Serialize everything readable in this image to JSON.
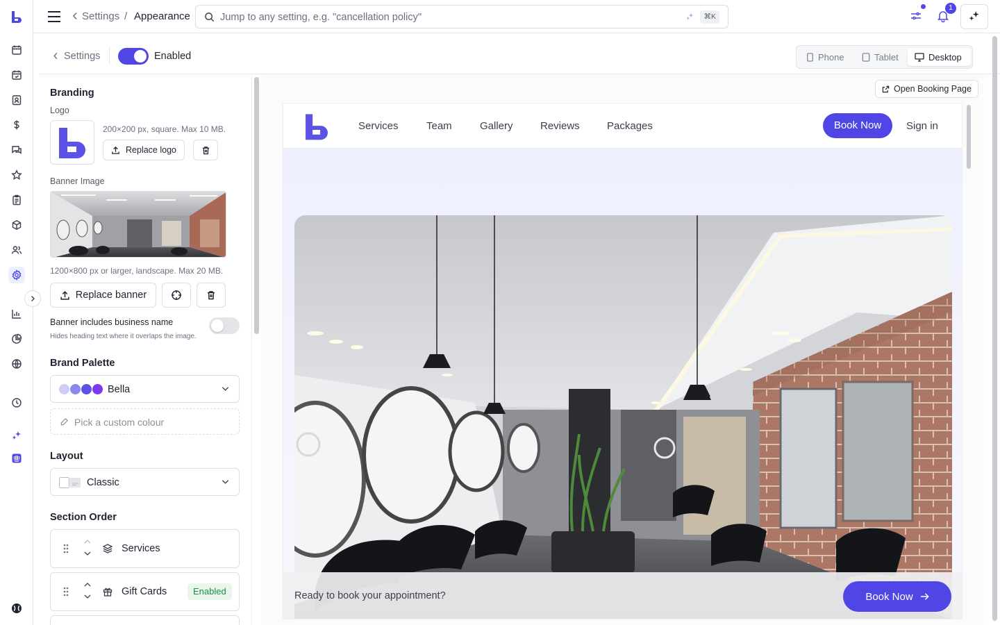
{
  "topbar": {
    "breadcrumb_parent": "Settings",
    "breadcrumb_sep": "/",
    "breadcrumb_current": "Appearance",
    "search_placeholder": "Jump to any setting, e.g. \"cancellation policy\"",
    "search_shortcut": "⌘K",
    "notification_count": "1"
  },
  "subheader": {
    "back_label": "Settings",
    "enabled_label": "Enabled",
    "devices": [
      "Phone",
      "Tablet",
      "Desktop"
    ],
    "selected_device": "Desktop"
  },
  "branding": {
    "heading": "Branding",
    "logo_label": "Logo",
    "logo_hint": "200×200 px, square. Max 10 MB.",
    "replace_logo": "Replace logo",
    "banner_label": "Banner Image",
    "banner_hint": "1200×800 px or larger, landscape. Max 20 MB.",
    "replace_banner": "Replace banner",
    "banner_name_label": "Banner includes business name",
    "banner_name_help": "Hides heading text where it overlaps the image."
  },
  "palette": {
    "heading": "Brand Palette",
    "selected": "Bella",
    "swatches": [
      "#cfcdf7",
      "#8d86ee",
      "#5d52e6",
      "#7c3aed"
    ],
    "custom_placeholder": "Pick a custom colour"
  },
  "layout": {
    "heading": "Layout",
    "selected": "Classic"
  },
  "section_order": {
    "heading": "Section Order",
    "items": [
      {
        "label": "Services",
        "badge": ""
      },
      {
        "label": "Gift Cards",
        "badge": "Enabled"
      }
    ]
  },
  "preview": {
    "open_booking": "Open Booking Page",
    "nav_links": [
      "Services",
      "Team",
      "Gallery",
      "Reviews",
      "Packages"
    ],
    "book_now": "Book Now",
    "sign_in": "Sign in",
    "cta_text": "Ready to book your appointment?",
    "cta_button": "Book Now"
  },
  "colors": {
    "accent": "#4f46e5",
    "enabled_badge_bg": "#e8f6ec",
    "enabled_badge_text": "#1f8a4c"
  }
}
